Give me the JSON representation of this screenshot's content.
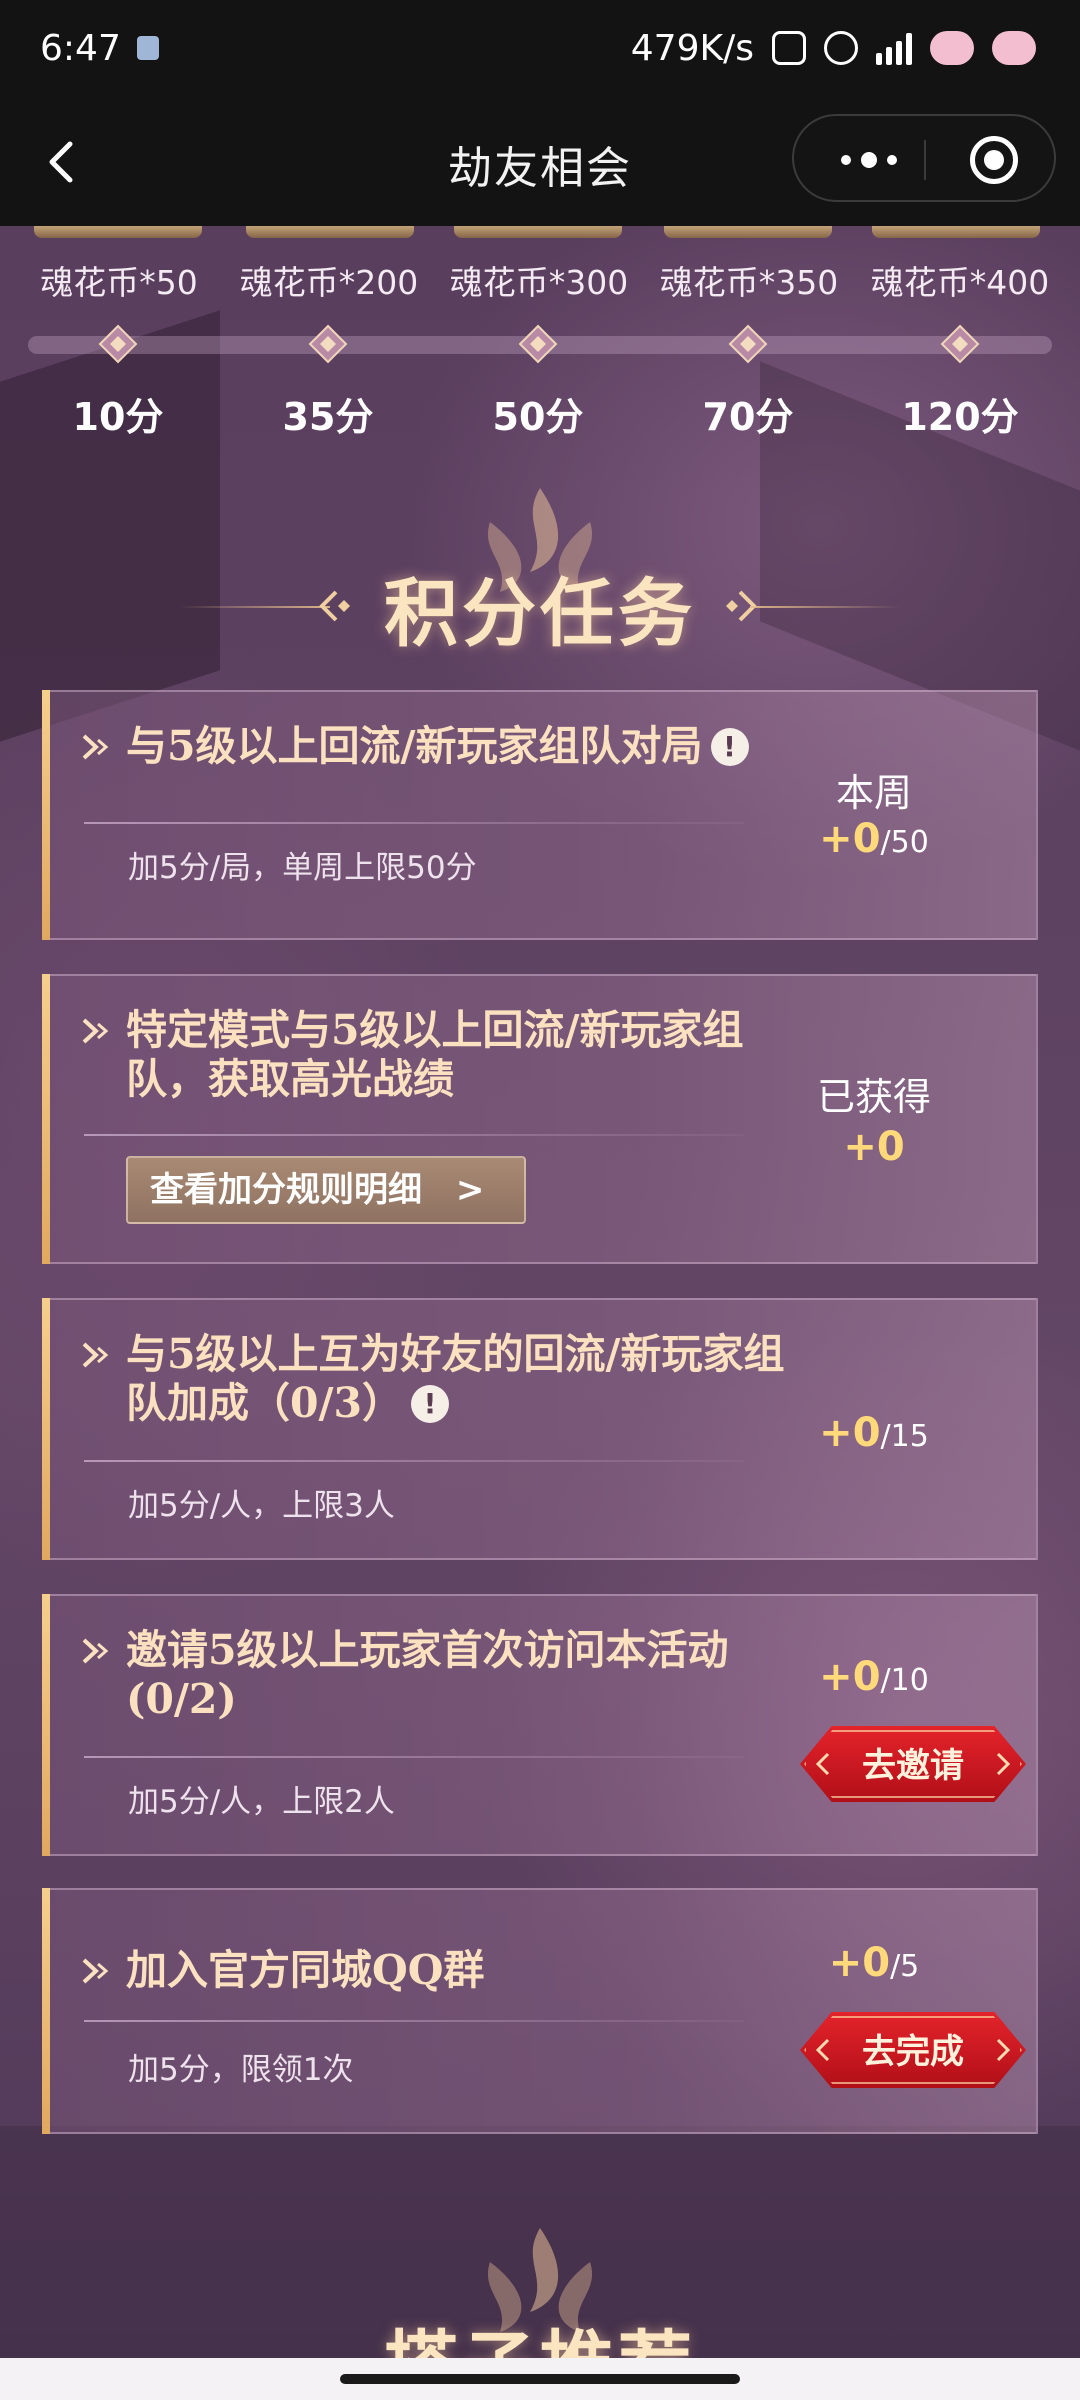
{
  "status_bar": {
    "time": "6:47",
    "net_speed": "479K/s"
  },
  "nav": {
    "title": "劫友相会"
  },
  "rewards": {
    "items": [
      {
        "label": "魂花币*50",
        "score": "10分"
      },
      {
        "label": "魂花币*200",
        "score": "35分"
      },
      {
        "label": "魂花币*300",
        "score": "50分"
      },
      {
        "label": "魂花币*350",
        "score": "70分"
      },
      {
        "label": "魂花币*400",
        "score": "120分"
      }
    ]
  },
  "section": {
    "title": "积分任务",
    "next_title": "搭子推荐"
  },
  "tasks": [
    {
      "title": "与5级以上回流/新玩家组队对局",
      "desc": "加5分/局，单周上限50分",
      "right_label": "本周",
      "gain": "+0",
      "limit": "/50"
    },
    {
      "title": "特定模式与5级以上回流/新玩家组队，获取高光战绩",
      "rule_button": "查看加分规则明细",
      "rule_arrow": ">",
      "right_label": "已获得",
      "gain": "+0"
    },
    {
      "title": "与5级以上互为好友的回流/新玩家组队加成（0/3）",
      "desc": "加5分/人，上限3人",
      "gain": "+0",
      "limit": "/15"
    },
    {
      "title": "邀请5级以上玩家首次访问本活动(0/2)",
      "desc": "加5分/人，上限2人",
      "gain": "+0",
      "limit": "/10",
      "button": "去邀请"
    },
    {
      "title": "加入官方同城QQ群",
      "desc": "加5分，限领1次",
      "gain": "+0",
      "limit": "/5",
      "button": "去完成"
    }
  ],
  "colors": {
    "accent_gold": "#fbe1c0",
    "score_yellow": "#ffd97a",
    "button_red": "#d11a22"
  }
}
